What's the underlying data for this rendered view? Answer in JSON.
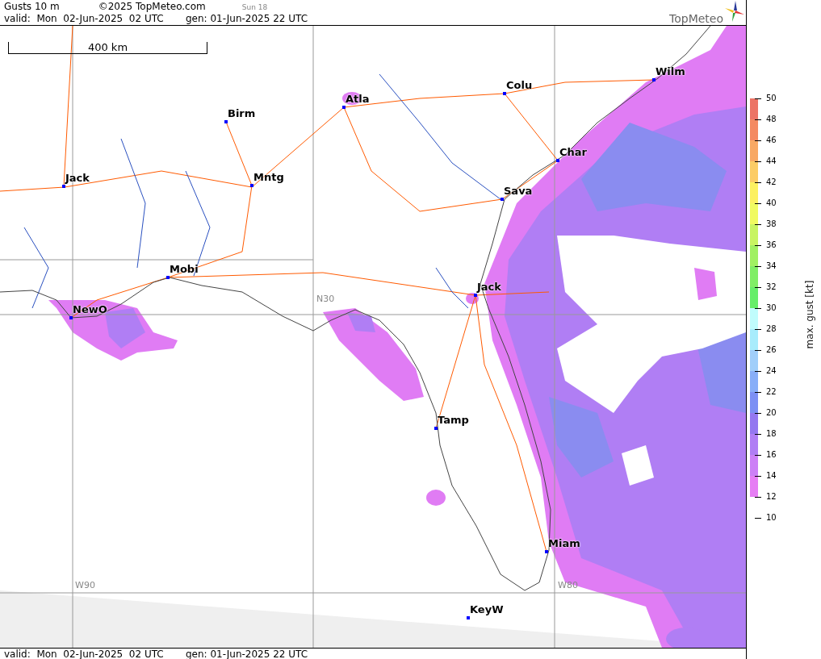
{
  "header": {
    "title": "Gusts 10 m",
    "copyright": "©2025 TopMeteo.com",
    "run": "Sun 18",
    "valid": "valid:  Mon  02-Jun-2025  02 UTC",
    "generated": "gen: 01-Jun-2025 22 UTC",
    "logo": "TopMeteo"
  },
  "map": {
    "scale_label": "400 km",
    "grid_labels": [
      "N30",
      "W90",
      "W80"
    ],
    "cities": [
      {
        "name": "Wilm"
      },
      {
        "name": "Colu"
      },
      {
        "name": "Atla"
      },
      {
        "name": "Birm"
      },
      {
        "name": "Char"
      },
      {
        "name": "Jack"
      },
      {
        "name": "Mntg"
      },
      {
        "name": "Sava"
      },
      {
        "name": "Mobi"
      },
      {
        "name": "Jack"
      },
      {
        "name": "NewO"
      },
      {
        "name": "Tamp"
      },
      {
        "name": "Miam"
      },
      {
        "name": "KeyW"
      }
    ]
  },
  "legend": {
    "title": "max. gust [kt]",
    "ticks": [
      "50",
      "48",
      "46",
      "44",
      "42",
      "40",
      "38",
      "36",
      "34",
      "32",
      "30",
      "28",
      "26",
      "24",
      "22",
      "20",
      "18",
      "16",
      "14",
      "12",
      "10"
    ],
    "bands": [
      {
        "color": "#ec7466"
      },
      {
        "color": "#f48a62"
      },
      {
        "color": "#f8a864"
      },
      {
        "color": "#fccc66"
      },
      {
        "color": "#fcf060"
      },
      {
        "color": "#f0fa60"
      },
      {
        "color": "#c8f462"
      },
      {
        "color": "#a0f062"
      },
      {
        "color": "#80ee66"
      },
      {
        "color": "#66ee6a"
      },
      {
        "color": "#c0fcfc"
      },
      {
        "color": "#a8ecfc"
      },
      {
        "color": "#a0cefa"
      },
      {
        "color": "#88aef8"
      },
      {
        "color": "#7c90f4"
      },
      {
        "color": "#9478f0"
      },
      {
        "color": "#b07ef4"
      },
      {
        "color": "#cc80f6"
      },
      {
        "color": "#e67ef4"
      }
    ]
  },
  "footer": {
    "valid": "valid:  Mon  02-Jun-2025  02 UTC",
    "generated": "gen: 01-Jun-2025 22 UTC"
  }
}
